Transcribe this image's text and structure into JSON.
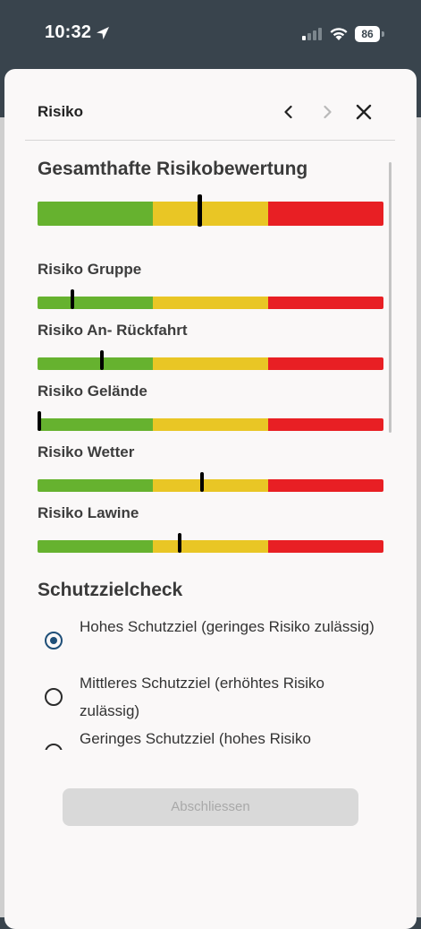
{
  "status_bar": {
    "time": "10:32",
    "battery": "86"
  },
  "modal": {
    "title": "Risiko",
    "overall": {
      "title": "Gesamthafte Risikobewertung",
      "level": 0.47
    },
    "risks": [
      {
        "label": "Risiko Gruppe",
        "level": 0.1
      },
      {
        "label": "Risiko An- Rückfahrt",
        "level": 0.185
      },
      {
        "label": "Risiko Gelände",
        "level": 0.0
      },
      {
        "label": "Risiko Wetter",
        "level": 0.475
      },
      {
        "label": "Risiko Lawine",
        "level": 0.41
      }
    ],
    "scale_colors": {
      "low": "#66b22f",
      "medium": "#e9c625",
      "high": "#e81f24"
    },
    "schutzziel": {
      "title": "Schutzzielcheck",
      "options": [
        {
          "label": "Hohes Schutzziel (geringes Risiko zulässig)",
          "selected": true
        },
        {
          "label": "Mittleres Schutzziel (erhöhtes Risiko zulässig)",
          "selected": false
        },
        {
          "label": "Geringes Schutzziel (hohes Risiko",
          "selected": false
        }
      ]
    },
    "action_button": "Abschliessen"
  }
}
